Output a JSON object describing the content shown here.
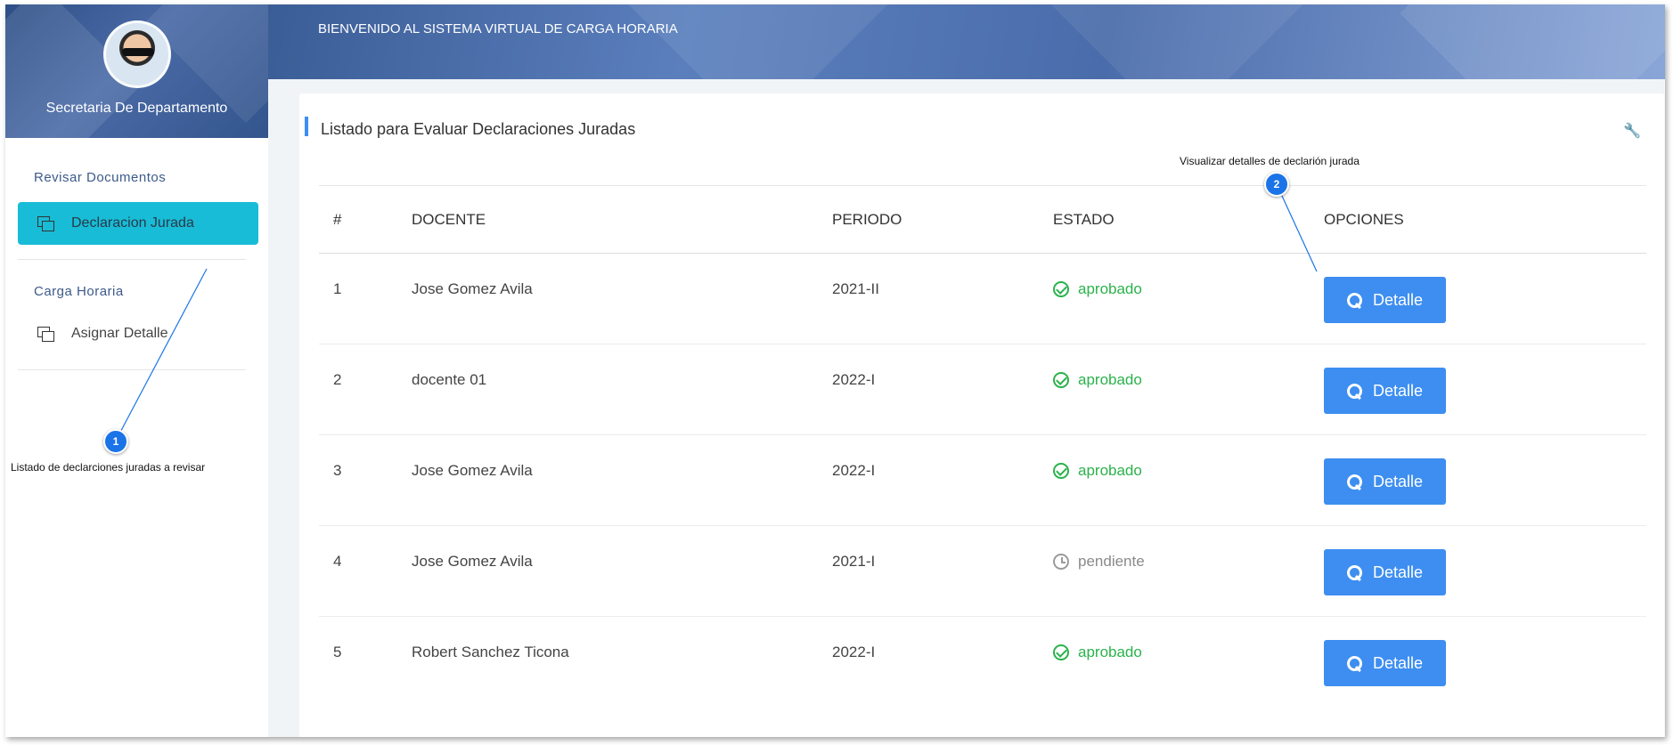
{
  "sidebar": {
    "user_name": "Secretaria De Departamento",
    "sections": [
      {
        "label": "Revisar Documentos",
        "items": [
          {
            "label": "Declaracion Jurada",
            "active": true
          }
        ]
      },
      {
        "label": "Carga Horaria",
        "items": [
          {
            "label": "Asignar Detalle",
            "active": false
          }
        ]
      }
    ]
  },
  "header": {
    "title": "BIENVENIDO AL SISTEMA VIRTUAL DE CARGA HORARIA"
  },
  "card": {
    "title": "Listado para Evaluar Declaraciones Juradas",
    "table": {
      "columns": [
        "#",
        "DOCENTE",
        "PERIODO",
        "ESTADO",
        "OPCIONES"
      ],
      "rows": [
        {
          "num": "1",
          "docente": "Jose Gomez Avila",
          "periodo": "2021-II",
          "estado": "aprobado",
          "button": "Detalle"
        },
        {
          "num": "2",
          "docente": "docente 01",
          "periodo": "2022-I",
          "estado": "aprobado",
          "button": "Detalle"
        },
        {
          "num": "3",
          "docente": "Jose Gomez Avila",
          "periodo": "2022-I",
          "estado": "aprobado",
          "button": "Detalle"
        },
        {
          "num": "4",
          "docente": "Jose Gomez Avila",
          "periodo": "2021-I",
          "estado": "pendiente",
          "button": "Detalle"
        },
        {
          "num": "5",
          "docente": "Robert Sanchez Ticona",
          "periodo": "2022-I",
          "estado": "aprobado",
          "button": "Detalle"
        }
      ]
    }
  },
  "callouts": [
    {
      "number": "1",
      "text": "Listado de declarciones juradas a revisar"
    },
    {
      "number": "2",
      "text": "Visualizar detalles de declarión jurada"
    }
  ],
  "colors": {
    "accent": "#3d8ef0",
    "active_nav": "#18bcd6",
    "approved": "#2bb24c",
    "pending": "#8a8a8a",
    "callout": "#1a74e8"
  },
  "icons": [
    "copy-icon",
    "check-circle-icon",
    "clock-icon",
    "search-icon",
    "wrench-icon"
  ]
}
